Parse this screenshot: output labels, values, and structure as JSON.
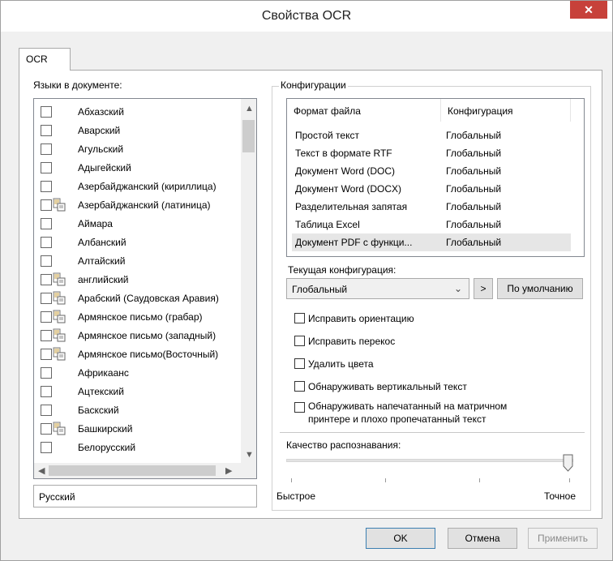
{
  "window": {
    "title": "Свойства OCR",
    "close_glyph": "✕",
    "accent_close": "#c7413a"
  },
  "tabs": [
    {
      "label": "OCR",
      "active": true
    }
  ],
  "languages": {
    "label": "Языки в документе:",
    "items": [
      {
        "name": "Абхазский",
        "checked": false,
        "dictionary": false
      },
      {
        "name": "Аварский",
        "checked": false,
        "dictionary": false
      },
      {
        "name": "Агульский",
        "checked": false,
        "dictionary": false
      },
      {
        "name": "Адыгейский",
        "checked": false,
        "dictionary": false
      },
      {
        "name": "Азербайджанский (кириллица)",
        "checked": false,
        "dictionary": false
      },
      {
        "name": "Азербайджанский (латиница)",
        "checked": false,
        "dictionary": true
      },
      {
        "name": "Аймара",
        "checked": false,
        "dictionary": false
      },
      {
        "name": "Албанский",
        "checked": false,
        "dictionary": false
      },
      {
        "name": "Алтайский",
        "checked": false,
        "dictionary": false
      },
      {
        "name": "английский",
        "checked": false,
        "dictionary": true
      },
      {
        "name": "Арабский (Саудовская Аравия)",
        "checked": false,
        "dictionary": true
      },
      {
        "name": "Армянское письмо (грабар)",
        "checked": false,
        "dictionary": true
      },
      {
        "name": "Армянское письмо (западный)",
        "checked": false,
        "dictionary": true
      },
      {
        "name": "Армянское письмо(Восточный)",
        "checked": false,
        "dictionary": true
      },
      {
        "name": "Африкаанс",
        "checked": false,
        "dictionary": false
      },
      {
        "name": "Ацтекский",
        "checked": false,
        "dictionary": false
      },
      {
        "name": "Баскский",
        "checked": false,
        "dictionary": false
      },
      {
        "name": "Башкирский",
        "checked": false,
        "dictionary": true
      },
      {
        "name": "Белорусский",
        "checked": false,
        "dictionary": false
      }
    ],
    "selected_text": "Русский"
  },
  "configurations": {
    "group_label": "Конфигурации",
    "columns": [
      "Формат файла",
      "Конфигурация"
    ],
    "rows": [
      [
        "Простой текст",
        "Глобальный"
      ],
      [
        "Текст в формате RTF",
        "Глобальный"
      ],
      [
        "Документ Word (DOC)",
        "Глобальный"
      ],
      [
        "Документ Word (DOCX)",
        "Глобальный"
      ],
      [
        "Разделительная запятая",
        "Глобальный"
      ],
      [
        "Таблица Excel",
        "Глобальный"
      ],
      [
        "Документ PDF с функци...",
        "Глобальный"
      ]
    ],
    "selected_row": 6,
    "current_label": "Текущая конфигурация:",
    "current_value": "Глобальный",
    "arrow_button": ">",
    "default_button": "По умолчанию"
  },
  "options": [
    {
      "label": "Исправить ориентацию",
      "checked": false
    },
    {
      "label": "Исправить перекос",
      "checked": false
    },
    {
      "label": "Удалить цвета",
      "checked": false
    },
    {
      "label": "Обнаруживать вертикальный текст",
      "checked": false
    },
    {
      "label": "Обнаруживать напечатанный на матричном",
      "label2": "принтере и плохо пропечатанный текст",
      "checked": false
    }
  ],
  "quality": {
    "label": "Качество распознавания:",
    "min_label": "Быстрое",
    "max_label": "Точное",
    "value_fraction": 1.0
  },
  "footer": {
    "ok": "OK",
    "cancel": "Отмена",
    "apply": "Применить"
  }
}
